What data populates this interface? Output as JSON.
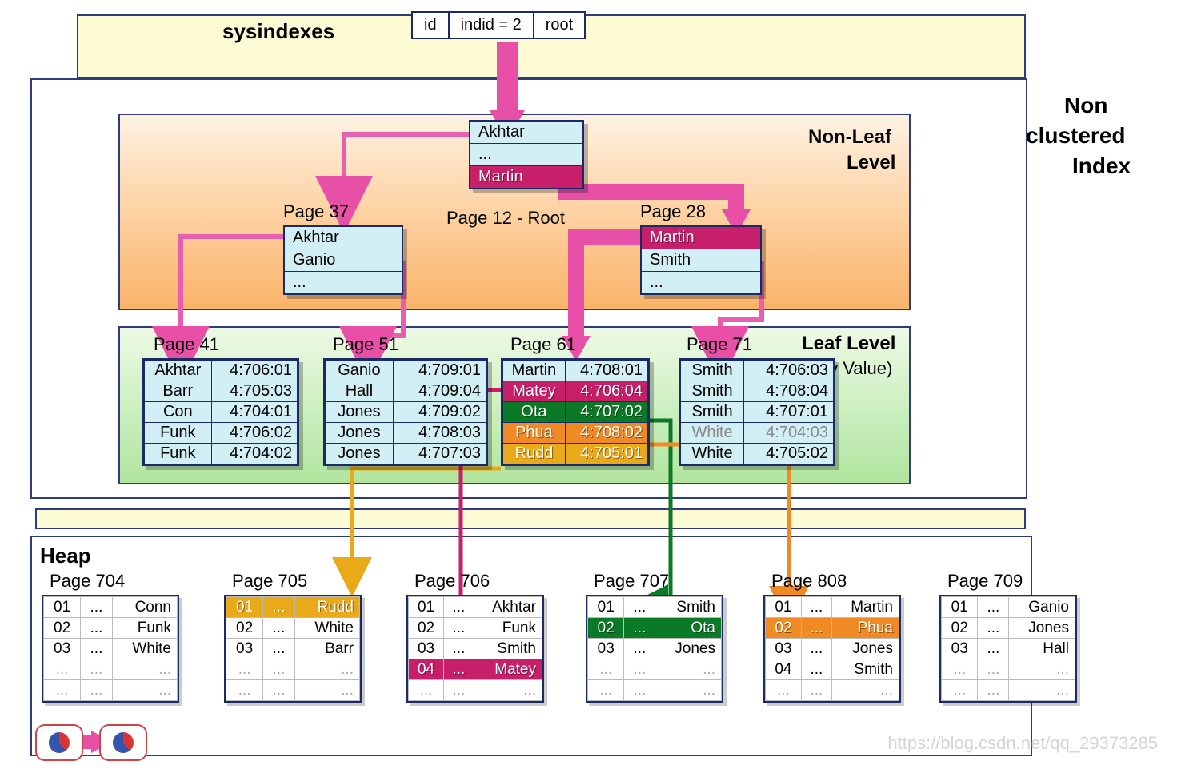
{
  "title": "sysindexes",
  "sys": {
    "c1": "id",
    "c2": "indid = 2",
    "c3": "root"
  },
  "side": {
    "l1": "Non",
    "l2": "clustered",
    "l3": "Index"
  },
  "nonleaf": {
    "title": "Non-Leaf",
    "title2": "Level"
  },
  "leaf": {
    "title": "Leaf Level",
    "sub": "(Key Value)"
  },
  "root": {
    "label": "Page 12 - Root",
    "rows": [
      "Akhtar",
      "...",
      "Martin"
    ]
  },
  "p37": {
    "label": "Page 37",
    "rows": [
      "Akhtar",
      "Ganio",
      "..."
    ]
  },
  "p28": {
    "label": "Page 28",
    "rows": [
      "Martin",
      "Smith",
      "..."
    ]
  },
  "leafs": {
    "p41": {
      "label": "Page 41",
      "rows": [
        [
          "Akhtar",
          "4:706:01"
        ],
        [
          "Barr",
          "4:705:03"
        ],
        [
          "Con",
          "4:704:01"
        ],
        [
          "Funk",
          "4:706:02"
        ],
        [
          "Funk",
          "4:704:02"
        ]
      ]
    },
    "p51": {
      "label": "Page 51",
      "rows": [
        [
          "Ganio",
          "4:709:01"
        ],
        [
          "Hall",
          "4:709:04"
        ],
        [
          "Jones",
          "4:709:02"
        ],
        [
          "Jones",
          "4:708:03"
        ],
        [
          "Jones",
          "4:707:03"
        ]
      ]
    },
    "p61": {
      "label": "Page 61",
      "rows": [
        [
          "Martin",
          "4:708:01"
        ],
        [
          "Matey",
          "4:706:04"
        ],
        [
          "Ota",
          "4:707:02"
        ],
        [
          "Phua",
          "4:708:02"
        ],
        [
          "Rudd",
          "4:705:01"
        ]
      ]
    },
    "p71": {
      "label": "Page 71",
      "rows": [
        [
          "Smith",
          "4:706:03"
        ],
        [
          "Smith",
          "4:708:04"
        ],
        [
          "Smith",
          "4:707:01"
        ],
        [
          "White",
          "4:704:03"
        ],
        [
          "White",
          "4:705:02"
        ]
      ]
    }
  },
  "heap": {
    "title": "Heap",
    "pages": [
      {
        "label": "Page 704",
        "rows": [
          [
            "01",
            "...",
            "Conn"
          ],
          [
            "02",
            "...",
            "Funk"
          ],
          [
            "03",
            "...",
            "White"
          ],
          [
            "...",
            "...",
            "..."
          ],
          [
            "...",
            "...",
            "..."
          ]
        ]
      },
      {
        "label": "Page 705",
        "rows": [
          [
            "01",
            "...",
            "Rudd"
          ],
          [
            "02",
            "...",
            "White"
          ],
          [
            "03",
            "...",
            "Barr"
          ],
          [
            "...",
            "...",
            "..."
          ],
          [
            "...",
            "...",
            "..."
          ]
        ]
      },
      {
        "label": "Page 706",
        "rows": [
          [
            "01",
            "...",
            "Akhtar"
          ],
          [
            "02",
            "...",
            "Funk"
          ],
          [
            "03",
            "...",
            "Smith"
          ],
          [
            "04",
            "...",
            "Matey"
          ],
          [
            "...",
            "...",
            "..."
          ]
        ]
      },
      {
        "label": "Page 707",
        "rows": [
          [
            "01",
            "...",
            "Smith"
          ],
          [
            "02",
            "...",
            "Ota"
          ],
          [
            "03",
            "...",
            "Jones"
          ],
          [
            "...",
            "...",
            "..."
          ],
          [
            "...",
            "...",
            "..."
          ]
        ]
      },
      {
        "label": "Page 808",
        "rows": [
          [
            "01",
            "...",
            "Martin"
          ],
          [
            "02",
            "...",
            "Phua"
          ],
          [
            "03",
            "...",
            "Jones"
          ],
          [
            "04",
            "...",
            "Smith"
          ],
          [
            "...",
            "...",
            "..."
          ]
        ]
      },
      {
        "label": "Page 709",
        "rows": [
          [
            "01",
            "...",
            "Ganio"
          ],
          [
            "02",
            "...",
            "Jones"
          ],
          [
            "03",
            "...",
            "Hall"
          ],
          [
            "...",
            "...",
            "..."
          ],
          [
            "...",
            "...",
            "..."
          ]
        ]
      }
    ]
  },
  "watermark": "https://blog.csdn.net/qq_29373285"
}
